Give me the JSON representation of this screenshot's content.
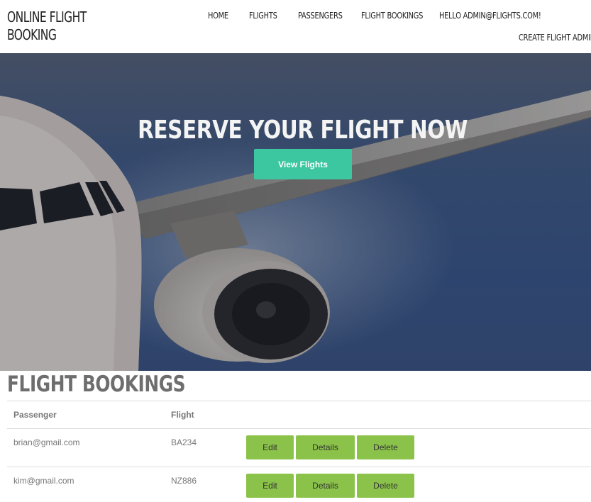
{
  "brand": {
    "line1": "ONLINE FLIGHT",
    "line2": "BOOKING"
  },
  "nav": {
    "home": "HOME",
    "flights": "FLIGHTS",
    "passengers": "PASSENGERS",
    "flight_bookings": "FLIGHT BOOKINGS",
    "user": "HELLO ADMIN@FLIGHTS.COM!",
    "create_admin": "CREATE FLIGHT ADMIN"
  },
  "hero": {
    "title": "RESERVE YOUR FLIGHT NOW",
    "button": "View Flights"
  },
  "bookings": {
    "title": "FLIGHT BOOKINGS",
    "columns": {
      "passenger": "Passenger",
      "flight": "Flight"
    },
    "rows": [
      {
        "passenger": "brian@gmail.com",
        "flight": "BA234",
        "edit": "Edit",
        "details": "Details",
        "delete": "Delete"
      },
      {
        "passenger": "kim@gmail.com",
        "flight": "NZ886",
        "edit": "Edit",
        "details": "Details",
        "delete": "Delete"
      }
    ]
  },
  "colors": {
    "accent": "#3cc7a0",
    "action_button": "#8bc34a",
    "hero_sky": "#375689"
  }
}
